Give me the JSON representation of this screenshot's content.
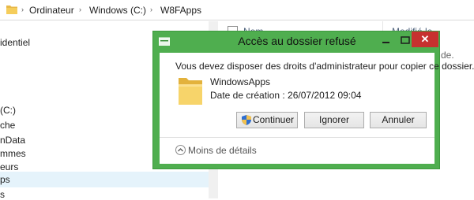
{
  "explorer": {
    "breadcrumb": [
      "Ordinateur",
      "Windows (C:)",
      "W8FApps"
    ],
    "columns": {
      "name": "Nom",
      "modified": "Modifié le"
    },
    "nav_items": [
      "identiel",
      "(C:)",
      "che",
      "nData",
      "mmes",
      "eurs",
      "ps",
      "s"
    ],
    "list_snippet": "de."
  },
  "dialog": {
    "title": "Accès au dossier refusé",
    "message": "Vous devez disposer des droits d'administrateur pour copier ce dossier.",
    "folder_name": "WindowsApps",
    "folder_date": "Date de création : 26/07/2012 09:04",
    "buttons": {
      "continue": "Continuer",
      "ignore": "Ignorer",
      "cancel": "Annuler"
    },
    "details": "Moins de détails",
    "close_glyph": "✕"
  },
  "colors": {
    "dialog_border": "#4fae4f",
    "close_button": "#c7312f",
    "folder": "#f2c94c"
  },
  "icons": [
    "folder-icon",
    "shield-icon",
    "chevron-up-icon",
    "minimize-icon",
    "maximize-icon",
    "close-icon"
  ]
}
